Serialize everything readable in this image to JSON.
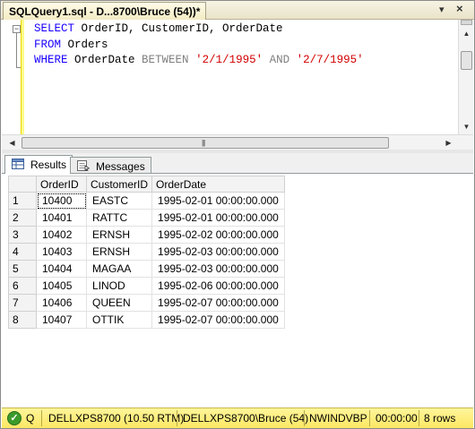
{
  "window": {
    "tab_title": "SQLQuery1.sql - D...8700\\Bruce (54))*",
    "pin_glyph": "▾",
    "close_glyph": "×"
  },
  "editor": {
    "lines": [
      [
        {
          "t": "SELECT",
          "c": "kw"
        },
        {
          "t": " OrderID, CustomerID, OrderDate",
          "c": ""
        }
      ],
      [
        {
          "t": "FROM",
          "c": "kw"
        },
        {
          "t": " Orders",
          "c": ""
        }
      ],
      [
        {
          "t": "WHERE",
          "c": "kw"
        },
        {
          "t": " OrderDate ",
          "c": ""
        },
        {
          "t": "BETWEEN",
          "c": "op"
        },
        {
          "t": " ",
          "c": ""
        },
        {
          "t": "'2/1/1995'",
          "c": "str"
        },
        {
          "t": " ",
          "c": ""
        },
        {
          "t": "AND",
          "c": "op"
        },
        {
          "t": " ",
          "c": ""
        },
        {
          "t": "'2/7/1995'",
          "c": "str"
        }
      ]
    ],
    "collapse_glyph": "−"
  },
  "result_tabs": {
    "results_label": "Results",
    "messages_label": "Messages"
  },
  "grid": {
    "columns": [
      "",
      "OrderID",
      "CustomerID",
      "OrderDate"
    ],
    "rows": [
      [
        "1",
        "10400",
        "EASTC",
        "1995-02-01 00:00:00.000"
      ],
      [
        "2",
        "10401",
        "RATTC",
        "1995-02-01 00:00:00.000"
      ],
      [
        "3",
        "10402",
        "ERNSH",
        "1995-02-02 00:00:00.000"
      ],
      [
        "4",
        "10403",
        "ERNSH",
        "1995-02-03 00:00:00.000"
      ],
      [
        "5",
        "10404",
        "MAGAA",
        "1995-02-03 00:00:00.000"
      ],
      [
        "6",
        "10405",
        "LINOD",
        "1995-02-06 00:00:00.000"
      ],
      [
        "7",
        "10406",
        "QUEEN",
        "1995-02-07 00:00:00.000"
      ],
      [
        "8",
        "10407",
        "OTTIK",
        "1995-02-07 00:00:00.000"
      ]
    ]
  },
  "status": {
    "state": "Q",
    "server": "DELLXPS8700 (10.50 RTM)",
    "user": "DELLXPS8700\\Bruce (54)",
    "database": "NWINDVBP",
    "elapsed": "00:00:00",
    "rows": "8 rows",
    "ok_glyph": "✓"
  },
  "colors": {
    "keyword": "#1900ff",
    "string": "#d20000",
    "operator": "#808080",
    "statusbar": "#fce763"
  }
}
